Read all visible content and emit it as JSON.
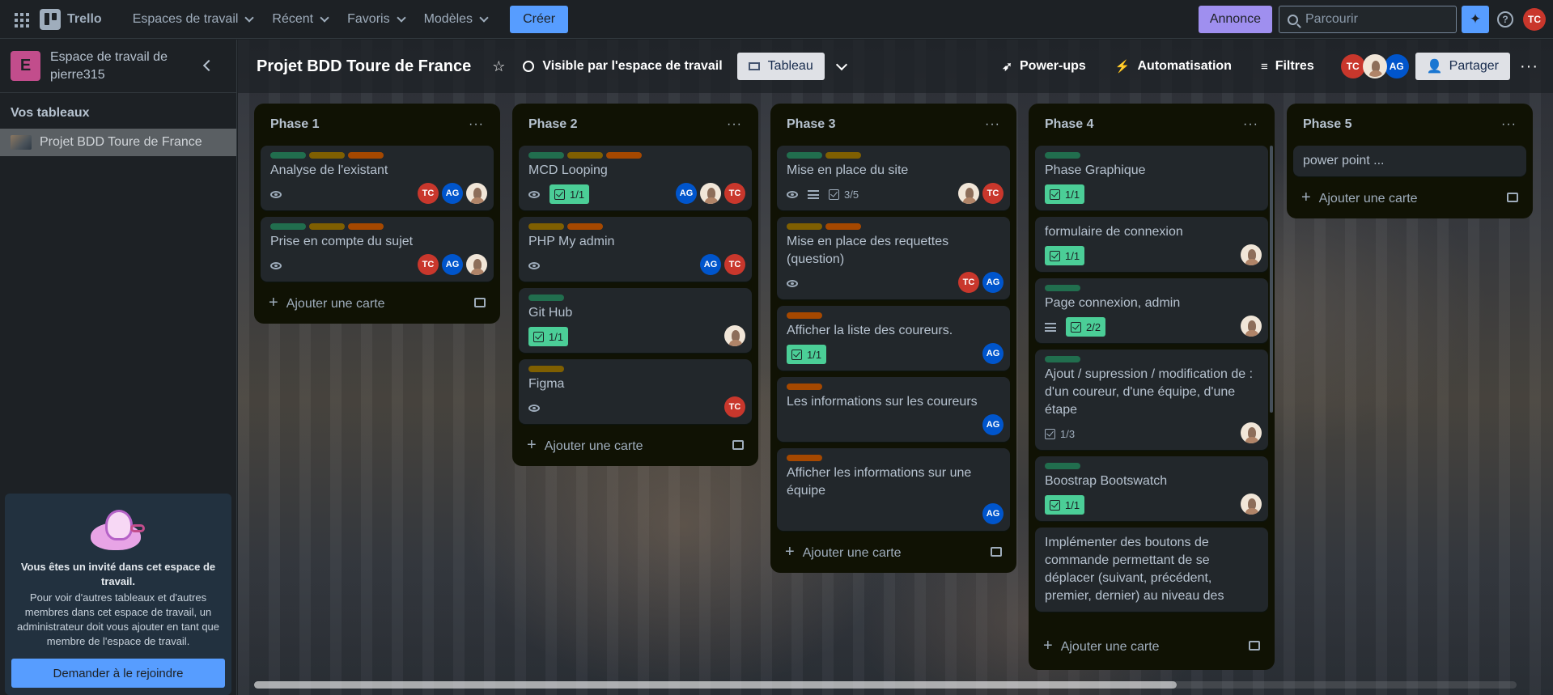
{
  "topbar": {
    "app_name": "Trello",
    "menu": [
      {
        "label": "Espaces de travail"
      },
      {
        "label": "Récent"
      },
      {
        "label": "Favoris"
      },
      {
        "label": "Modèles"
      }
    ],
    "create_label": "Créer",
    "annonce_label": "Annonce",
    "search_placeholder": "Parcourir",
    "user_initials": "TC"
  },
  "sidebar": {
    "workspace_initial": "E",
    "workspace_name": "Espace de travail de pierre315",
    "section_title": "Vos tableaux",
    "board_item": "Projet BDD Toure de France",
    "invite": {
      "title": "Vous êtes un invité dans cet espace de travail.",
      "text": "Pour voir d'autres tableaux et d'autres membres dans cet espace de travail, un administrateur doit vous ajouter en tant que membre de l'espace de travail.",
      "button": "Demander à le rejoindre"
    }
  },
  "board": {
    "title": "Projet BDD Toure de France",
    "visibility": "Visible par l'espace de travail",
    "view": "Tableau",
    "powerups": "Power-ups",
    "automation": "Automatisation",
    "filters": "Filtres",
    "members": [
      "TC",
      "AG"
    ],
    "share": "Partager",
    "add_card_label": "Ajouter une carte",
    "lists": [
      {
        "title": "Phase 1",
        "cards": [
          {
            "title": "Analyse de l'existant",
            "labels": [
              "green",
              "yellow",
              "orange"
            ],
            "watch": true,
            "members": [
              "TC",
              "AG",
              "img"
            ]
          },
          {
            "title": "Prise en compte du sujet",
            "labels": [
              "green",
              "yellow",
              "orange"
            ],
            "watch": true,
            "members": [
              "TC",
              "AG",
              "img"
            ]
          }
        ]
      },
      {
        "title": "Phase 2",
        "cards": [
          {
            "title": "MCD Looping",
            "labels": [
              "green",
              "yellow",
              "orange"
            ],
            "watch": true,
            "checklist": "1/1",
            "checklist_done": true,
            "members": [
              "AG",
              "img",
              "TC"
            ]
          },
          {
            "title": "PHP My admin",
            "labels": [
              "yellow",
              "orange"
            ],
            "watch": true,
            "members": [
              "AG",
              "TC"
            ]
          },
          {
            "title": "Git Hub",
            "labels": [
              "green"
            ],
            "checklist": "1/1",
            "checklist_done": true,
            "members": [
              "img"
            ]
          },
          {
            "title": "Figma",
            "labels": [
              "yellow"
            ],
            "watch": true,
            "members": [
              "TC"
            ]
          }
        ]
      },
      {
        "title": "Phase 3",
        "cards": [
          {
            "title": "Mise en place du site",
            "labels": [
              "green",
              "yellow"
            ],
            "watch": true,
            "desc": true,
            "checklist": "3/5",
            "checklist_done": false,
            "members": [
              "img",
              "TC"
            ]
          },
          {
            "title": "Mise en place des requettes (question)",
            "labels": [
              "yellow",
              "orange"
            ],
            "watch": true,
            "members": [
              "TC",
              "AG"
            ]
          },
          {
            "title": "Afficher la liste des coureurs.",
            "labels": [
              "orange"
            ],
            "checklist": "1/1",
            "checklist_done": true,
            "members": [
              "AG"
            ]
          },
          {
            "title": "Les informations sur les coureurs",
            "labels": [
              "orange"
            ],
            "members": [
              "AG"
            ]
          },
          {
            "title": "Afficher les informations sur une équipe",
            "labels": [
              "orange"
            ],
            "members": [
              "AG"
            ]
          }
        ]
      },
      {
        "title": "Phase 4",
        "cards": [
          {
            "title": "Phase Graphique",
            "labels": [
              "green"
            ],
            "checklist": "1/1",
            "checklist_done": true,
            "members": []
          },
          {
            "title": "formulaire de connexion",
            "labels": [],
            "checklist": "1/1",
            "checklist_done": true,
            "members": [
              "img"
            ]
          },
          {
            "title": "Page connexion, admin",
            "labels": [
              "green"
            ],
            "desc": true,
            "checklist": "2/2",
            "checklist_done": true,
            "members": [
              "img"
            ]
          },
          {
            "title": "Ajout / supression / modification de : d'un coureur, d'une équipe, d'une étape",
            "labels": [
              "green"
            ],
            "checklist": "1/3",
            "checklist_done": false,
            "members": [
              "img"
            ]
          },
          {
            "title": "Boostrap Bootswatch",
            "labels": [
              "green"
            ],
            "checklist": "1/1",
            "checklist_done": true,
            "members": [
              "img"
            ]
          },
          {
            "title": "Implémenter des boutons de commande permettant de se déplacer (suivant, précédent, premier, dernier) au niveau des",
            "labels": [],
            "members": []
          }
        ]
      },
      {
        "title": "Phase 5",
        "cards": [
          {
            "title": "power point ...",
            "labels": [],
            "members": []
          }
        ]
      }
    ]
  }
}
